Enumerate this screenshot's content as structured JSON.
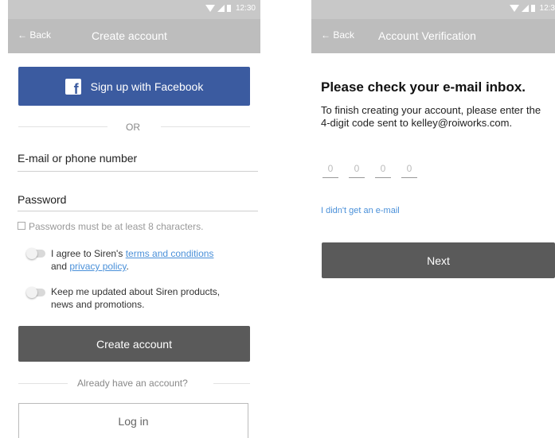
{
  "status_bar": {
    "time_left": "12:30",
    "time_right": "12:3"
  },
  "create_account": {
    "back_label": "← Back",
    "title": "Create account",
    "facebook_button": "Sign up with Facebook",
    "or_label": "OR",
    "email_label": "E-mail or phone number",
    "password_label": "Password",
    "password_hint": "Passwords must be at least 8 characters.",
    "agree_prefix": "I agree to Siren's ",
    "terms_link": "terms and conditions",
    "and_text": "and ",
    "privacy_link": "privacy policy",
    "period": ".",
    "updates_line1": "Keep me updated about Siren products,",
    "updates_line2": "news and promotions.",
    "create_button": "Create account",
    "have_account": "Already have an account?",
    "login_button": "Log in"
  },
  "verification": {
    "back_label": "← Back",
    "title": "Account Verification",
    "heading": "Please check your e-mail inbox.",
    "instructions": "To finish creating your account, please enter the 4-digit code sent to kelley@roiworks.com.",
    "code_digits": [
      "0",
      "0",
      "0",
      "0"
    ],
    "no_email_link": "I didn't get an e-mail",
    "next_button": "Next"
  },
  "colors": {
    "facebook": "#3b5ba0",
    "primary_button": "#5a5a5a",
    "link": "#4a90d9",
    "app_bar": "#bdbdbd"
  }
}
